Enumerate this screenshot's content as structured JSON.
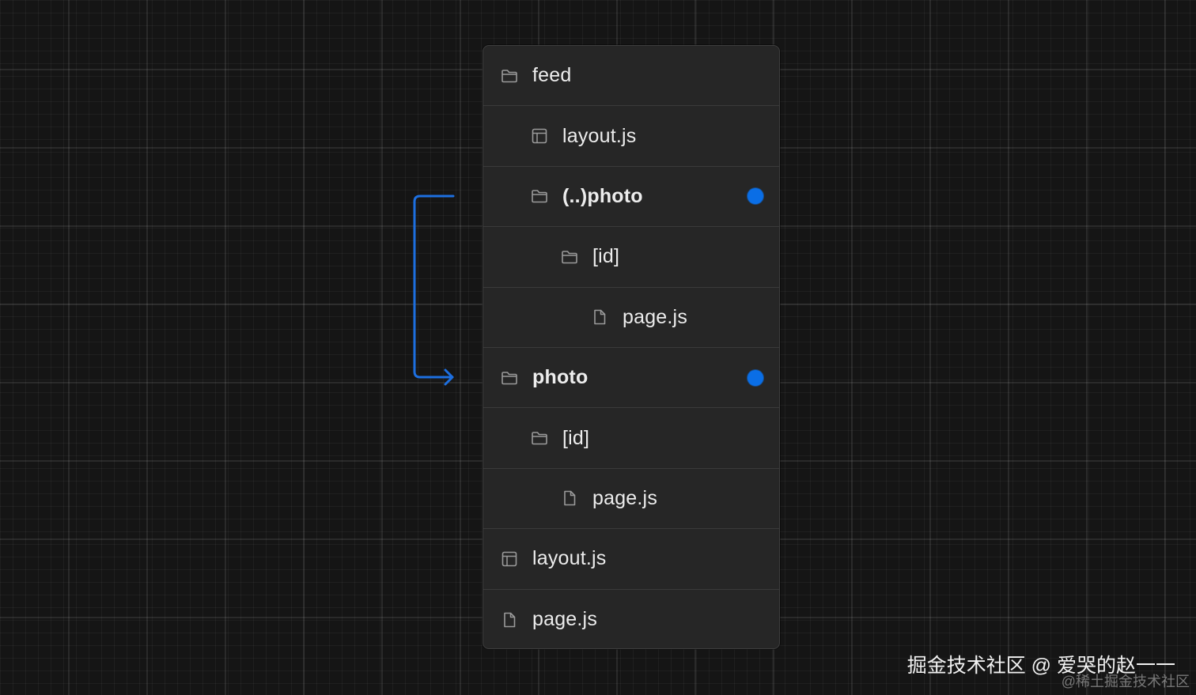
{
  "colors": {
    "background": "#151515",
    "panel": "#262626",
    "divider": "#3a3a3a",
    "text": "#ededed",
    "accent": "#0a6ee6",
    "icon": "#9a9a9a"
  },
  "tree": {
    "rows": [
      {
        "label": "feed",
        "icon": "folder-icon",
        "depth": 0,
        "bold": false,
        "marked": false
      },
      {
        "label": "layout.js",
        "icon": "layout-icon",
        "depth": 1,
        "bold": false,
        "marked": false
      },
      {
        "label": "(..)photo",
        "icon": "folder-icon",
        "depth": 1,
        "bold": true,
        "marked": true
      },
      {
        "label": "[id]",
        "icon": "folder-icon",
        "depth": 2,
        "bold": false,
        "marked": false
      },
      {
        "label": "page.js",
        "icon": "file-icon",
        "depth": 3,
        "bold": false,
        "marked": false
      },
      {
        "label": "photo",
        "icon": "folder-icon",
        "depth": 0,
        "bold": true,
        "marked": true
      },
      {
        "label": "[id]",
        "icon": "folder-icon",
        "depth": 1,
        "bold": false,
        "marked": false
      },
      {
        "label": "page.js",
        "icon": "file-icon",
        "depth": 2,
        "bold": false,
        "marked": false
      },
      {
        "label": "layout.js",
        "icon": "layout-icon",
        "depth": 0,
        "bold": false,
        "marked": false
      },
      {
        "label": "page.js",
        "icon": "file-icon",
        "depth": 0,
        "bold": false,
        "marked": false
      }
    ]
  },
  "connector": {
    "from": "(..)photo",
    "to": "photo",
    "icon": "bracket-arrow-icon"
  },
  "watermark": {
    "main": "掘金技术社区 @ 爱哭的赵一一",
    "sub": "@稀土掘金技术社区"
  }
}
